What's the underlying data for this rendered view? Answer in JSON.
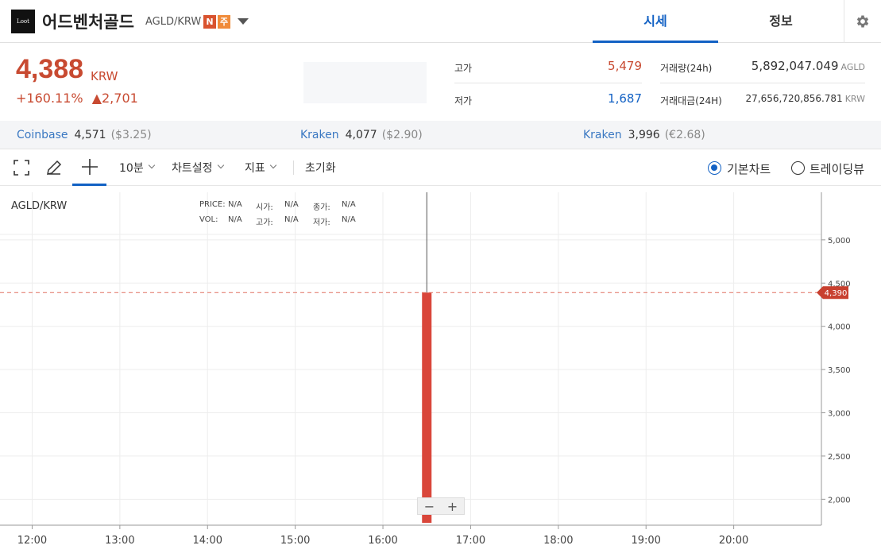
{
  "header": {
    "logo_text": "Loot",
    "coin_name": "어드벤처골드",
    "pair": "AGLD/KRW",
    "badge_new": "N",
    "badge_warn": "주",
    "tab_price": "시세",
    "tab_info": "정보"
  },
  "price": {
    "current": "4,388",
    "unit": "KRW",
    "change_pct": "+160.11%",
    "change_amount": "▲2,701"
  },
  "stats": {
    "high_label": "고가",
    "high_value": "5,479",
    "low_label": "저가",
    "low_value": "1,687",
    "volume_label": "거래량(24h)",
    "volume_value": "5,892,047.049",
    "volume_unit": "AGLD",
    "amount_label": "거래대금(24H)",
    "amount_value": "27,656,720,856.781",
    "amount_unit": "KRW"
  },
  "exchanges": [
    {
      "name": "Coinbase",
      "value": "4,571",
      "sub": "($3.25)"
    },
    {
      "name": "Kraken",
      "value": "4,077",
      "sub": "($2.90)"
    },
    {
      "name": "Kraken",
      "value": "3,996",
      "sub": "(€2.68)"
    }
  ],
  "toolbar": {
    "interval": "10분",
    "chart_settings": "차트설정",
    "indicators": "지표",
    "reset": "초기화",
    "basic_chart": "기본차트",
    "tradingview": "트레이딩뷰"
  },
  "ohlc": {
    "price_label": "PRICE:",
    "price_value": "N/A",
    "open_label": "시가:",
    "open_value": "N/A",
    "close_label": "종가:",
    "close_value": "N/A",
    "vol_label": "VOL:",
    "vol_value": "N/A",
    "high_label": "고가:",
    "high_value": "N/A",
    "low_label": "저가:",
    "low_value": "N/A"
  },
  "colors": {
    "up": "#c84a31",
    "down": "#1261c4",
    "accent": "#1261c4",
    "candle": "#d9463a"
  },
  "chart_data": {
    "type": "candlestick",
    "pair": "AGLD/KRW",
    "x_ticks": [
      "12:00",
      "13:00",
      "14:00",
      "15:00",
      "16:00",
      "17:00",
      "18:00",
      "19:00",
      "20:00"
    ],
    "y_ticks": [
      "2,000",
      "2,500",
      "3,000",
      "3,500",
      "4,000",
      "4,500",
      "5,000"
    ],
    "ylim": [
      1700,
      5550
    ],
    "xlim": [
      "11:38",
      "21:00"
    ],
    "current_price": 4390,
    "current_price_label": "4,390",
    "candles": [
      {
        "time": "16:30",
        "open": 1700,
        "high": 5479,
        "low": 1700,
        "close": 4390
      }
    ],
    "grid": true
  }
}
